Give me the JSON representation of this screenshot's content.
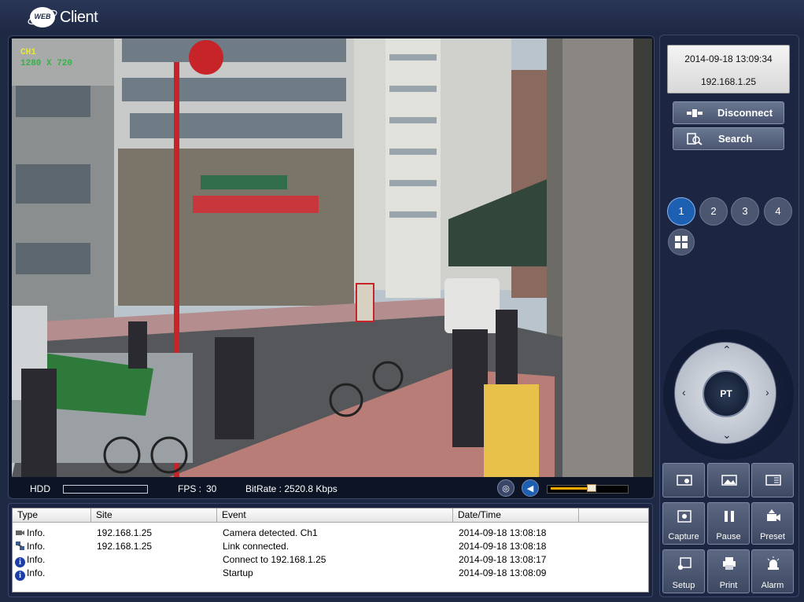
{
  "header": {
    "logo_badge": "WEB",
    "logo_text": "Client"
  },
  "video": {
    "channel": "CH1",
    "resolution": "1280 X 720"
  },
  "statusbar": {
    "hdd_label": "HDD",
    "hdd_usage_fraction": 0.0,
    "fps_label": "FPS :",
    "fps_value": "30",
    "bitrate": "BitRate : 2520.8 Kbps",
    "volume_fraction": 0.55
  },
  "log": {
    "columns": [
      "Type",
      "Site",
      "Event",
      "Date/Time"
    ],
    "rows": [
      {
        "icon": "camera-icon",
        "type": "Info.",
        "site": "192.168.1.25",
        "event": "Camera detected. Ch1",
        "datetime": "2014-09-18 13:08:18"
      },
      {
        "icon": "network-icon",
        "type": "Info.",
        "site": "192.168.1.25",
        "event": "Link connected.",
        "datetime": "2014-09-18 13:08:18"
      },
      {
        "icon": "info-icon",
        "type": "Info.",
        "site": "",
        "event": "Connect to 192.168.1.25",
        "datetime": "2014-09-18 13:08:17"
      },
      {
        "icon": "info-icon",
        "type": "Info.",
        "site": "",
        "event": "Startup",
        "datetime": "2014-09-18 13:08:09"
      }
    ]
  },
  "sidebar": {
    "datetime": "2014-09-18 13:09:34",
    "ip": "192.168.1.25",
    "disconnect_label": "Disconnect",
    "search_label": "Search",
    "channels": [
      "1",
      "2",
      "3",
      "4"
    ],
    "active_channel": "1",
    "ptz_label": "PT",
    "buttons": {
      "capture": "Capture",
      "pause": "Pause",
      "preset": "Preset",
      "setup": "Setup",
      "print": "Print",
      "alarm": "Alarm"
    }
  },
  "colors": {
    "background": "#1e2a44",
    "accent_blue": "#1d5fb0",
    "volume": "#ffa800"
  }
}
